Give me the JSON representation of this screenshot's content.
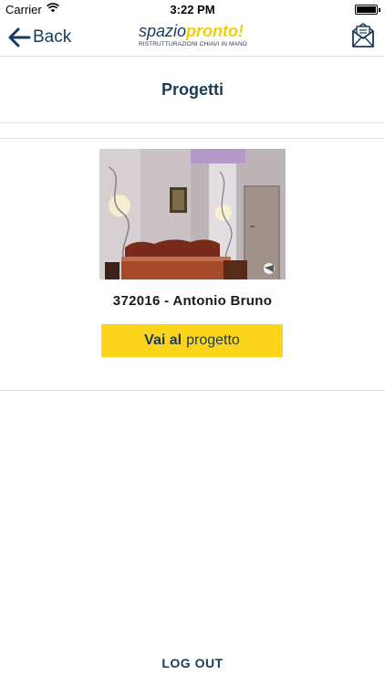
{
  "status_bar": {
    "carrier": "Carrier",
    "time": "3:22 PM"
  },
  "nav": {
    "back_label": "Back",
    "logo": {
      "word_a": "spazio",
      "word_b": "pronto!",
      "tagline": "RISTRUTTURAZIONI CHIAVI IN MANO"
    }
  },
  "page": {
    "title": "Progetti"
  },
  "project": {
    "name": "372016 - Antonio Bruno",
    "cta_bold": "Vai al",
    "cta_rest": "progetto"
  },
  "footer": {
    "logout_label": "LOG OUT"
  },
  "colors": {
    "brand_navy": "#1a3a5c",
    "brand_yellow": "#fcd51a"
  },
  "icons": {
    "back": "arrow-left-icon",
    "mail": "mail-icon",
    "wifi": "wifi-icon",
    "battery": "battery-icon"
  }
}
